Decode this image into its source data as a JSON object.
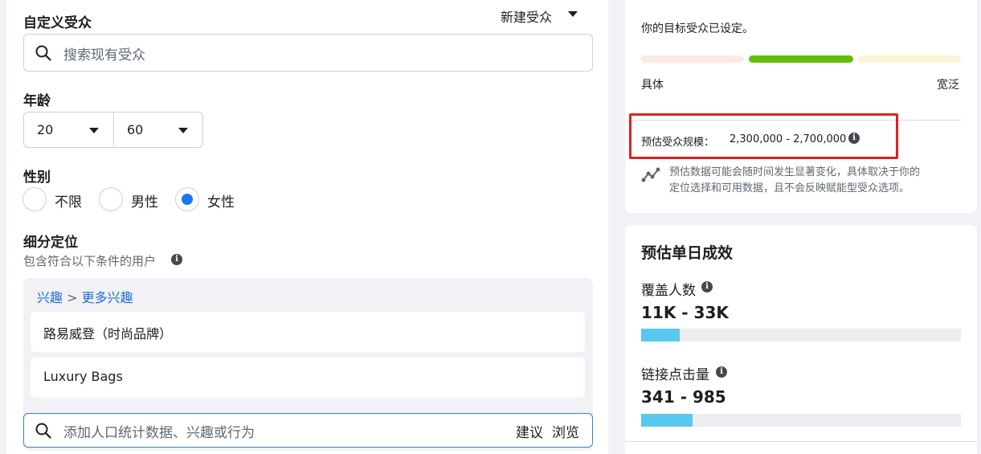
{
  "audience": {
    "title": "自定义受众",
    "new_label": "新建受众",
    "search_placeholder": "搜索现有受众"
  },
  "age": {
    "title": "年龄",
    "min": "20",
    "max": "60"
  },
  "gender": {
    "title": "性别",
    "options": [
      {
        "label": "不限",
        "selected": false
      },
      {
        "label": "男性",
        "selected": false
      },
      {
        "label": "女性",
        "selected": true
      }
    ]
  },
  "detailed_targeting": {
    "title": "细分定位",
    "subtitle": "包含符合以下条件的用户",
    "breadcrumb_root": "兴趣",
    "breadcrumb_sep": ">",
    "breadcrumb_child": "更多兴趣",
    "items": [
      "路易威登（时尚品牌）",
      "Luxury Bags"
    ],
    "search_placeholder": "添加人口统计数据、兴趣或行为",
    "suggest_label": "建议",
    "browse_label": "浏览"
  },
  "audience_definition": {
    "status_text": "你的目标受众已设定。",
    "specific_label": "具体",
    "broad_label": "宽泛",
    "size_label": "预估受众规模：",
    "size_value": "2,300,000 - 2,700,000",
    "disclaimer_line1": "预估数据可能会随时间发生显著变化，具体取决于你的",
    "disclaimer_line2": "定位选择和可用数据，且不会反映赋能型受众选项。"
  },
  "daily_results": {
    "title": "预估单日成效",
    "reach_label": "覆盖人数",
    "reach_value": "11K - 33K",
    "reach_fill_pct": 12,
    "clicks_label": "链接点击量",
    "clicks_value": "341 - 985",
    "clicks_fill_pct": 16
  },
  "colors": {
    "accent": "#1877f2",
    "link": "#216fdb",
    "highlight_border": "#e02020",
    "meter_specific": "#fde8e4",
    "meter_active": "#63be09",
    "meter_broad": "#fdf3d5",
    "progress_fill": "#59c8ee"
  },
  "icons": {
    "search": "search-icon",
    "caret": "caret-down-icon",
    "info": "info-icon",
    "trend": "trend-line-icon"
  }
}
